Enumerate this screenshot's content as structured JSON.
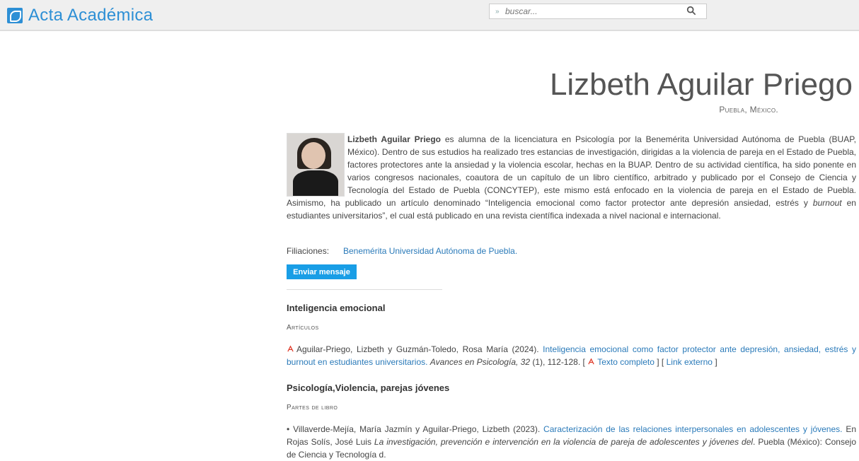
{
  "header": {
    "site_title": "Acta Académica",
    "search_placeholder": "buscar..."
  },
  "profile": {
    "name": "Lizbeth Aguilar Priego",
    "location": "Puebla, México.",
    "bio_name": "Lizbeth Aguilar Priego",
    "bio_text_1": " es alumna de la licenciatura en Psicología por la Benemérita Universidad Autónoma de Puebla (BUAP, México). Dentro de sus estudios ha realizado tres estancias de investigación, dirigidas a la violencia de pareja en el Estado de Puebla, factores protectores ante la ansiedad y la violencia escolar, hechas en la BUAP. Dentro de su actividad científica, ha sido ponente en varios congresos nacionales, coautora de un capítulo de un libro científico, arbitrado y publicado por el Consejo de Ciencia y Tecnología del Estado de Puebla (CONCYTEP), este mismo está enfocado en la violencia de pareja en el Estado de Puebla. Asimismo, ha publicado un artículo denominado “Inteligencia emocional como factor protector ante depresión ansiedad, estrés y ",
    "bio_em": "burnout",
    "bio_text_2": " en estudiantes universitarios”, el cual está publicado en una revista científica indexada a nivel nacional e internacional.",
    "affiliations_label": "Filiaciones:",
    "affiliation": "Benemérita Universidad Autónoma de Puebla.",
    "message_button": "Enviar mensaje"
  },
  "sections": [
    {
      "title": "Inteligencia emocional",
      "subtitle": "Artículos",
      "entry_authors": "Aguilar-Priego, Lizbeth y Guzmán-Toledo, Rosa María (2024). ",
      "entry_link": "Inteligencia emocional como factor protector ante depresión, ansiedad, estrés y burnout en estudiantes universitarios.",
      "entry_journal": "Avances en Psicología, 32",
      "entry_rest": " (1), 112-128. [",
      "full_text": "Texto completo",
      "mid": "] [",
      "external": "Link externo",
      "end": "]"
    },
    {
      "title": "Psicología,Violencia, parejas jóvenes",
      "subtitle": "Partes de libro",
      "entry_bullet": "•",
      "entry_authors": "Villaverde-Mejía, María Jazmín y Aguilar-Priego, Lizbeth (2023). ",
      "entry_link": "Caracterización de las relaciones interpersonales en adolescentes y jóvenes.",
      "entry_in": " En Rojas Solís, José Luis ",
      "entry_book": "La investigación, prevención e intervención en la violencia de pareja de adolescentes y jóvenes del",
      "entry_rest": ". Puebla (México): Consejo de Ciencia y Tecnología d."
    }
  ],
  "colors": {
    "accent": "#2d8fd5",
    "link": "#2a7ab9",
    "button": "#199ee6"
  },
  "icons": [
    "logo-icon",
    "search-icon",
    "chevron-down-icon",
    "pdf-icon"
  ]
}
